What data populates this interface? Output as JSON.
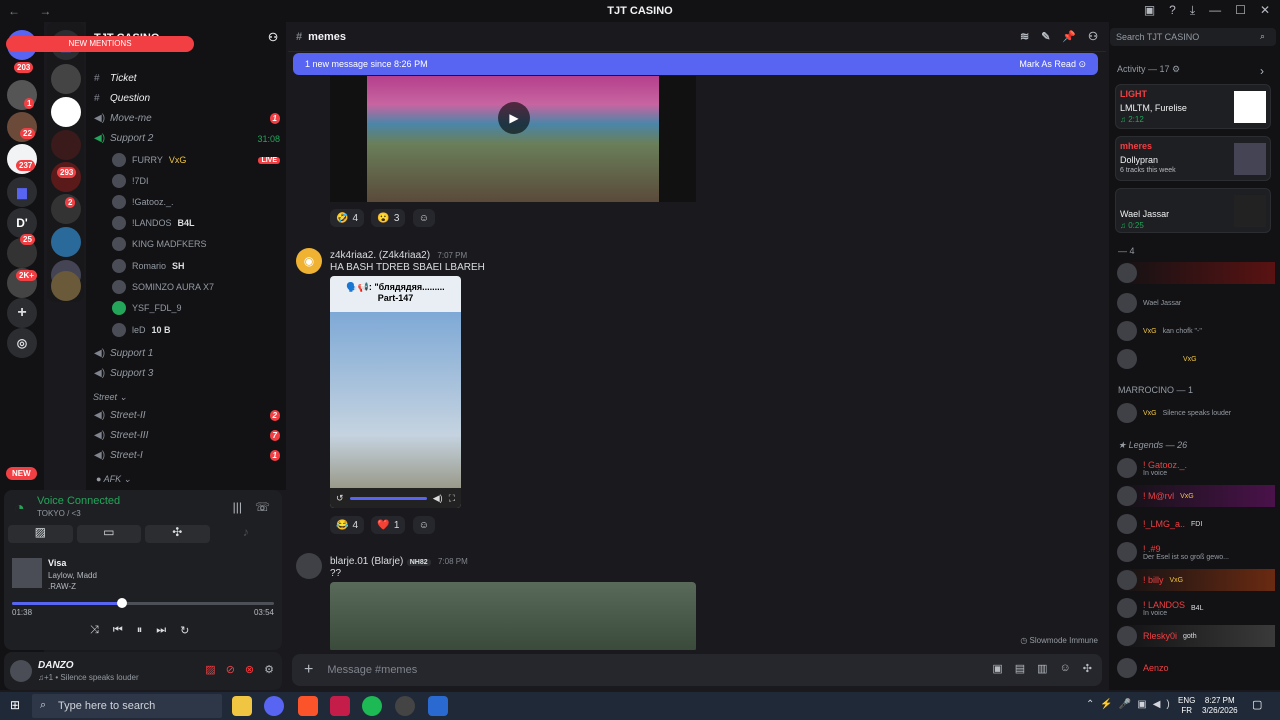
{
  "titlebar": {
    "title": "TJT CASINO"
  },
  "servers": {
    "badges": [
      "203",
      "1",
      "22",
      "237",
      "293",
      "2",
      "25",
      "2K+"
    ]
  },
  "sidebar": {
    "server_name": "TJT CASINO",
    "new_mentions": "NEW MENTIONS",
    "channels": [
      {
        "name": "Ticket"
      },
      {
        "name": "Question"
      },
      {
        "name": "Move-me",
        "badge": "1"
      },
      {
        "name": "Support 2",
        "time": "31:08"
      }
    ],
    "voice_users": [
      {
        "name": "FURRY",
        "tag": "VxG",
        "live": "LIVE"
      },
      {
        "name": "!7DI"
      },
      {
        "name": "!Gatooz._."
      },
      {
        "name": "!LANDOS",
        "tag": "B4L"
      },
      {
        "name": "KING MADFKERS"
      },
      {
        "name": "Romario",
        "tag": "SH"
      },
      {
        "name": "SOMINZO AURA X7"
      },
      {
        "name": "YSF_FDL_9"
      },
      {
        "name": "leD",
        "tag": "10 B"
      }
    ],
    "channels2": [
      {
        "name": "Support 1"
      },
      {
        "name": "Support 3"
      }
    ],
    "category_street": "Street",
    "street_channels": [
      {
        "name": "Street-II",
        "badge": "2"
      },
      {
        "name": "Street-III",
        "badge": "7"
      },
      {
        "name": "Street-I",
        "badge": "1"
      }
    ],
    "category_afk": "AFK",
    "new_label": "NEW"
  },
  "voice": {
    "status": "Voice Connected",
    "channel": "TOKYO / <3",
    "track": "Visa",
    "artists": "Laylow, Madd",
    "album": ".RAW-Z",
    "elapsed": "01:38",
    "total": "03:54",
    "progress": 0.42
  },
  "user": {
    "name": "DANZO",
    "status": "Silence speaks louder"
  },
  "channel": {
    "name": "memes",
    "new_since": "1 new message since 8:26 PM",
    "mark_read": "Mark As Read",
    "composer_placeholder": "Message #memes",
    "slowmode": "Slowmode Immune"
  },
  "messages": [
    {
      "reactions": [
        {
          "emoji": "🤣",
          "count": "4"
        },
        {
          "emoji": "😮",
          "count": "3"
        }
      ]
    },
    {
      "author": "z4k4riaa2. (Z4k4riaa2)",
      "time": "7:07 PM",
      "text": "HA BASH TDREB SBAEI LBAREH",
      "img_caption": "🗣️📢: \"блядядяя.........",
      "img_part": "Part-147",
      "reactions": [
        {
          "emoji": "😂",
          "count": "4"
        },
        {
          "emoji": "❤️",
          "count": "1"
        }
      ]
    },
    {
      "author": "blarje.01 (Blarje)",
      "tag": "NH82",
      "time": "7:08 PM",
      "text": "??"
    }
  ],
  "right": {
    "search": "Search TJT CASINO",
    "activity_header": "Activity — 17",
    "activities": [
      {
        "title": "LIGHT",
        "names": "LMLTM, Furelise",
        "meta": "♫ 2:12"
      },
      {
        "title": "mheres",
        "names": "Dollypran",
        "meta": "6 tracks this week"
      },
      {
        "title": "",
        "names": "Wael Jassar",
        "meta": "♫ 0:25"
      }
    ],
    "group1": "— 4",
    "group1_members": [
      {
        "name": "",
        "status": ""
      },
      {
        "name": "",
        "status": "Wael Jassar"
      },
      {
        "name": "",
        "tag": "VxG",
        "status": "kan chofk \"-\""
      },
      {
        "name": "",
        "tag": "VxG",
        "status": ""
      }
    ],
    "group2": "MARROCINO — 1",
    "group2_members": [
      {
        "name": "",
        "tag": "VxG",
        "status": "Silence speaks louder"
      }
    ],
    "group3": "Legends — 26",
    "group3_members": [
      {
        "name": "! Gatooz._.",
        "status": "In voice"
      },
      {
        "name": "! M@rvl",
        "tag": "VxG",
        "status": ""
      },
      {
        "name": "!_LMG_a..",
        "tag": "FDI",
        "status": ""
      },
      {
        "name": "! .#9",
        "status": "Der Esel ist so groß gewo..."
      },
      {
        "name": "! billy",
        "tag": "VxG",
        "status": ""
      },
      {
        "name": "! LANDOS",
        "tag": "B4L",
        "status": "In voice"
      },
      {
        "name": "Rlesky0i",
        "tag": "goth",
        "status": ""
      },
      {
        "name": "Aenzo",
        "status": ""
      }
    ]
  },
  "taskbar": {
    "search": "Type here to search",
    "lang1": "ENG",
    "lang2": "FR",
    "time": "8:27 PM",
    "date": "3/26/2026"
  },
  "colors": {
    "accent": "#5865f2",
    "red": "#f23f43",
    "green": "#23a55a"
  }
}
